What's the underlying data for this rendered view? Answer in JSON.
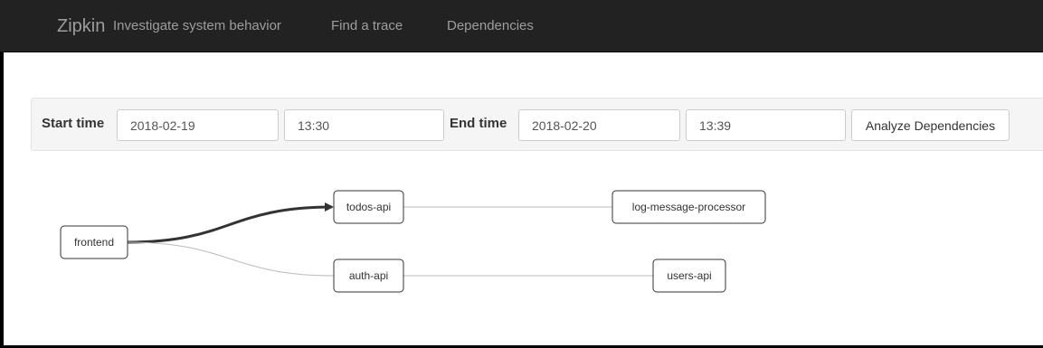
{
  "navbar": {
    "brand": "Zipkin",
    "links": [
      "Investigate system behavior",
      "Find a trace",
      "Dependencies"
    ]
  },
  "toolbar": {
    "start_time_label": "Start time",
    "start_date": "2018-02-19",
    "start_time": "13:30",
    "end_time_label": "End time",
    "end_date": "2018-02-20",
    "end_time": "13:39",
    "analyze_button": "Analyze Dependencies"
  },
  "graph": {
    "nodes": [
      "frontend",
      "todos-api",
      "log-message-processor",
      "auth-api",
      "users-api"
    ],
    "edges": [
      {
        "from": "frontend",
        "to": "todos-api",
        "heavy": true
      },
      {
        "from": "todos-api",
        "to": "log-message-processor",
        "heavy": false
      },
      {
        "from": "frontend",
        "to": "auth-api",
        "heavy": false
      },
      {
        "from": "auth-api",
        "to": "users-api",
        "heavy": false
      }
    ],
    "colors": {
      "node_border": "#333333",
      "heavy_edge": "#333333",
      "light_edge": "#bbbbbb"
    }
  }
}
